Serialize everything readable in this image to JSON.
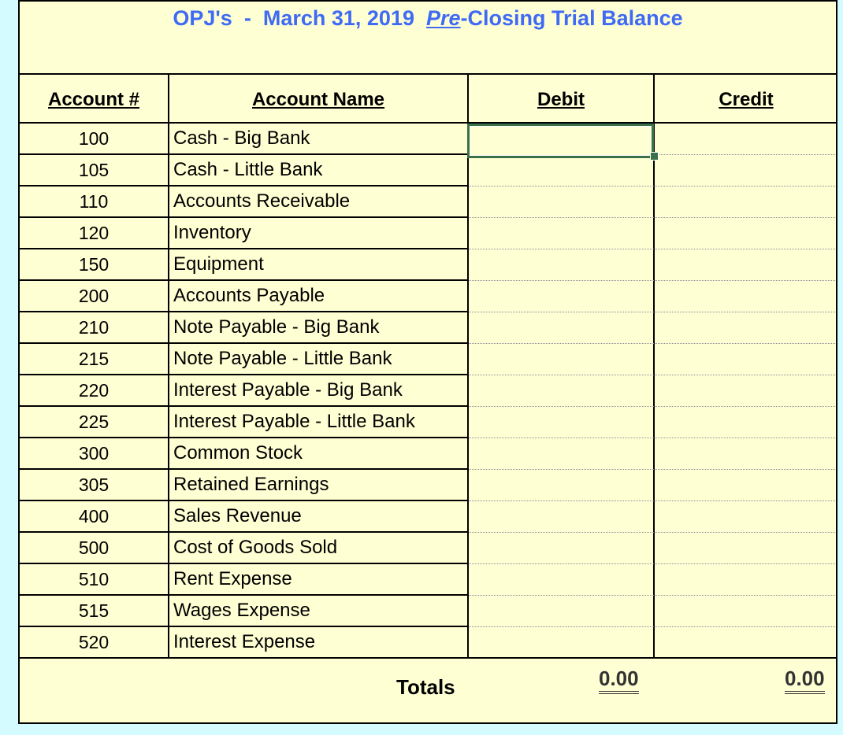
{
  "title": {
    "company": "OPJ's",
    "separator": "-",
    "date": "March 31, 2019",
    "emphasis": "Pre",
    "suffix": "-Closing Trial Balance"
  },
  "headers": {
    "account_number": "Account #",
    "account_name": "Account Name",
    "debit": "Debit",
    "credit": "Credit"
  },
  "rows": [
    {
      "number": "100",
      "name": "Cash - Big Bank",
      "debit": "",
      "credit": ""
    },
    {
      "number": "105",
      "name": "Cash - Little Bank",
      "debit": "",
      "credit": ""
    },
    {
      "number": "110",
      "name": "Accounts Receivable",
      "debit": "",
      "credit": ""
    },
    {
      "number": "120",
      "name": "Inventory",
      "debit": "",
      "credit": ""
    },
    {
      "number": "150",
      "name": "Equipment",
      "debit": "",
      "credit": ""
    },
    {
      "number": "200",
      "name": "Accounts Payable",
      "debit": "",
      "credit": ""
    },
    {
      "number": "210",
      "name": "Note Payable - Big Bank",
      "debit": "",
      "credit": ""
    },
    {
      "number": "215",
      "name": "Note Payable - Little Bank",
      "debit": "",
      "credit": ""
    },
    {
      "number": "220",
      "name": "Interest Payable - Big Bank",
      "debit": "",
      "credit": ""
    },
    {
      "number": "225",
      "name": "Interest Payable - Little Bank",
      "debit": "",
      "credit": ""
    },
    {
      "number": "300",
      "name": "Common Stock",
      "debit": "",
      "credit": ""
    },
    {
      "number": "305",
      "name": "Retained Earnings",
      "debit": "",
      "credit": ""
    },
    {
      "number": "400",
      "name": "Sales Revenue",
      "debit": "",
      "credit": ""
    },
    {
      "number": "500",
      "name": "Cost of Goods Sold",
      "debit": "",
      "credit": ""
    },
    {
      "number": "510",
      "name": "Rent Expense",
      "debit": "",
      "credit": ""
    },
    {
      "number": "515",
      "name": "Wages Expense",
      "debit": "",
      "credit": ""
    },
    {
      "number": "520",
      "name": "Interest Expense",
      "debit": "",
      "credit": ""
    }
  ],
  "totals": {
    "label": "Totals",
    "debit": "0.00",
    "credit": "0.00"
  },
  "selection": {
    "row": 0,
    "column": "debit"
  },
  "colors": {
    "title": "#3f6af4",
    "sheet_bg": "#ffffd4",
    "page_bg": "#d4fbff",
    "selection": "#3a7149"
  }
}
